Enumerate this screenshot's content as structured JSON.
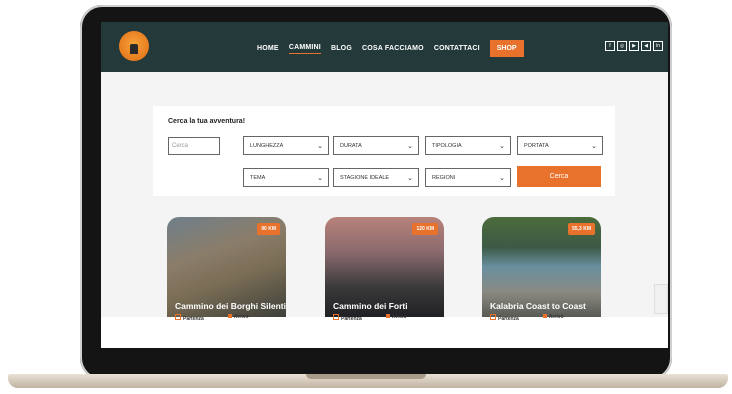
{
  "nav": {
    "items": [
      "HOME",
      "CAMMINI",
      "BLOG",
      "COSA FACCIAMO",
      "CONTATTACI"
    ],
    "active": "CAMMINI",
    "shop": "SHOP",
    "social": [
      "f",
      "◎",
      "▶",
      "◀",
      "in"
    ]
  },
  "search": {
    "title": "Cerca la tua avventura!",
    "placeholder": "Cerca",
    "selects": [
      "LUNGHEZZA",
      "DURATA",
      "TIPOLOGIA",
      "PORTATA",
      "TEMA",
      "STAGIONE IDEALE",
      "REGIONI"
    ],
    "button": "Cerca"
  },
  "cards": [
    {
      "name": "Cammino dei Borghi Silenti",
      "km": "90 KM",
      "start": "Partenza",
      "end": "Arrivo"
    },
    {
      "name": "Cammino dei Forti",
      "km": "120 KM",
      "start": "Partenza",
      "end": "Arrivo"
    },
    {
      "name": "Kalabria Coast to Coast",
      "km": "55,3 KM",
      "start": "Partenza",
      "end": "Arrivo"
    }
  ],
  "colors": {
    "accent": "#e8722c",
    "header": "#243a3a"
  }
}
